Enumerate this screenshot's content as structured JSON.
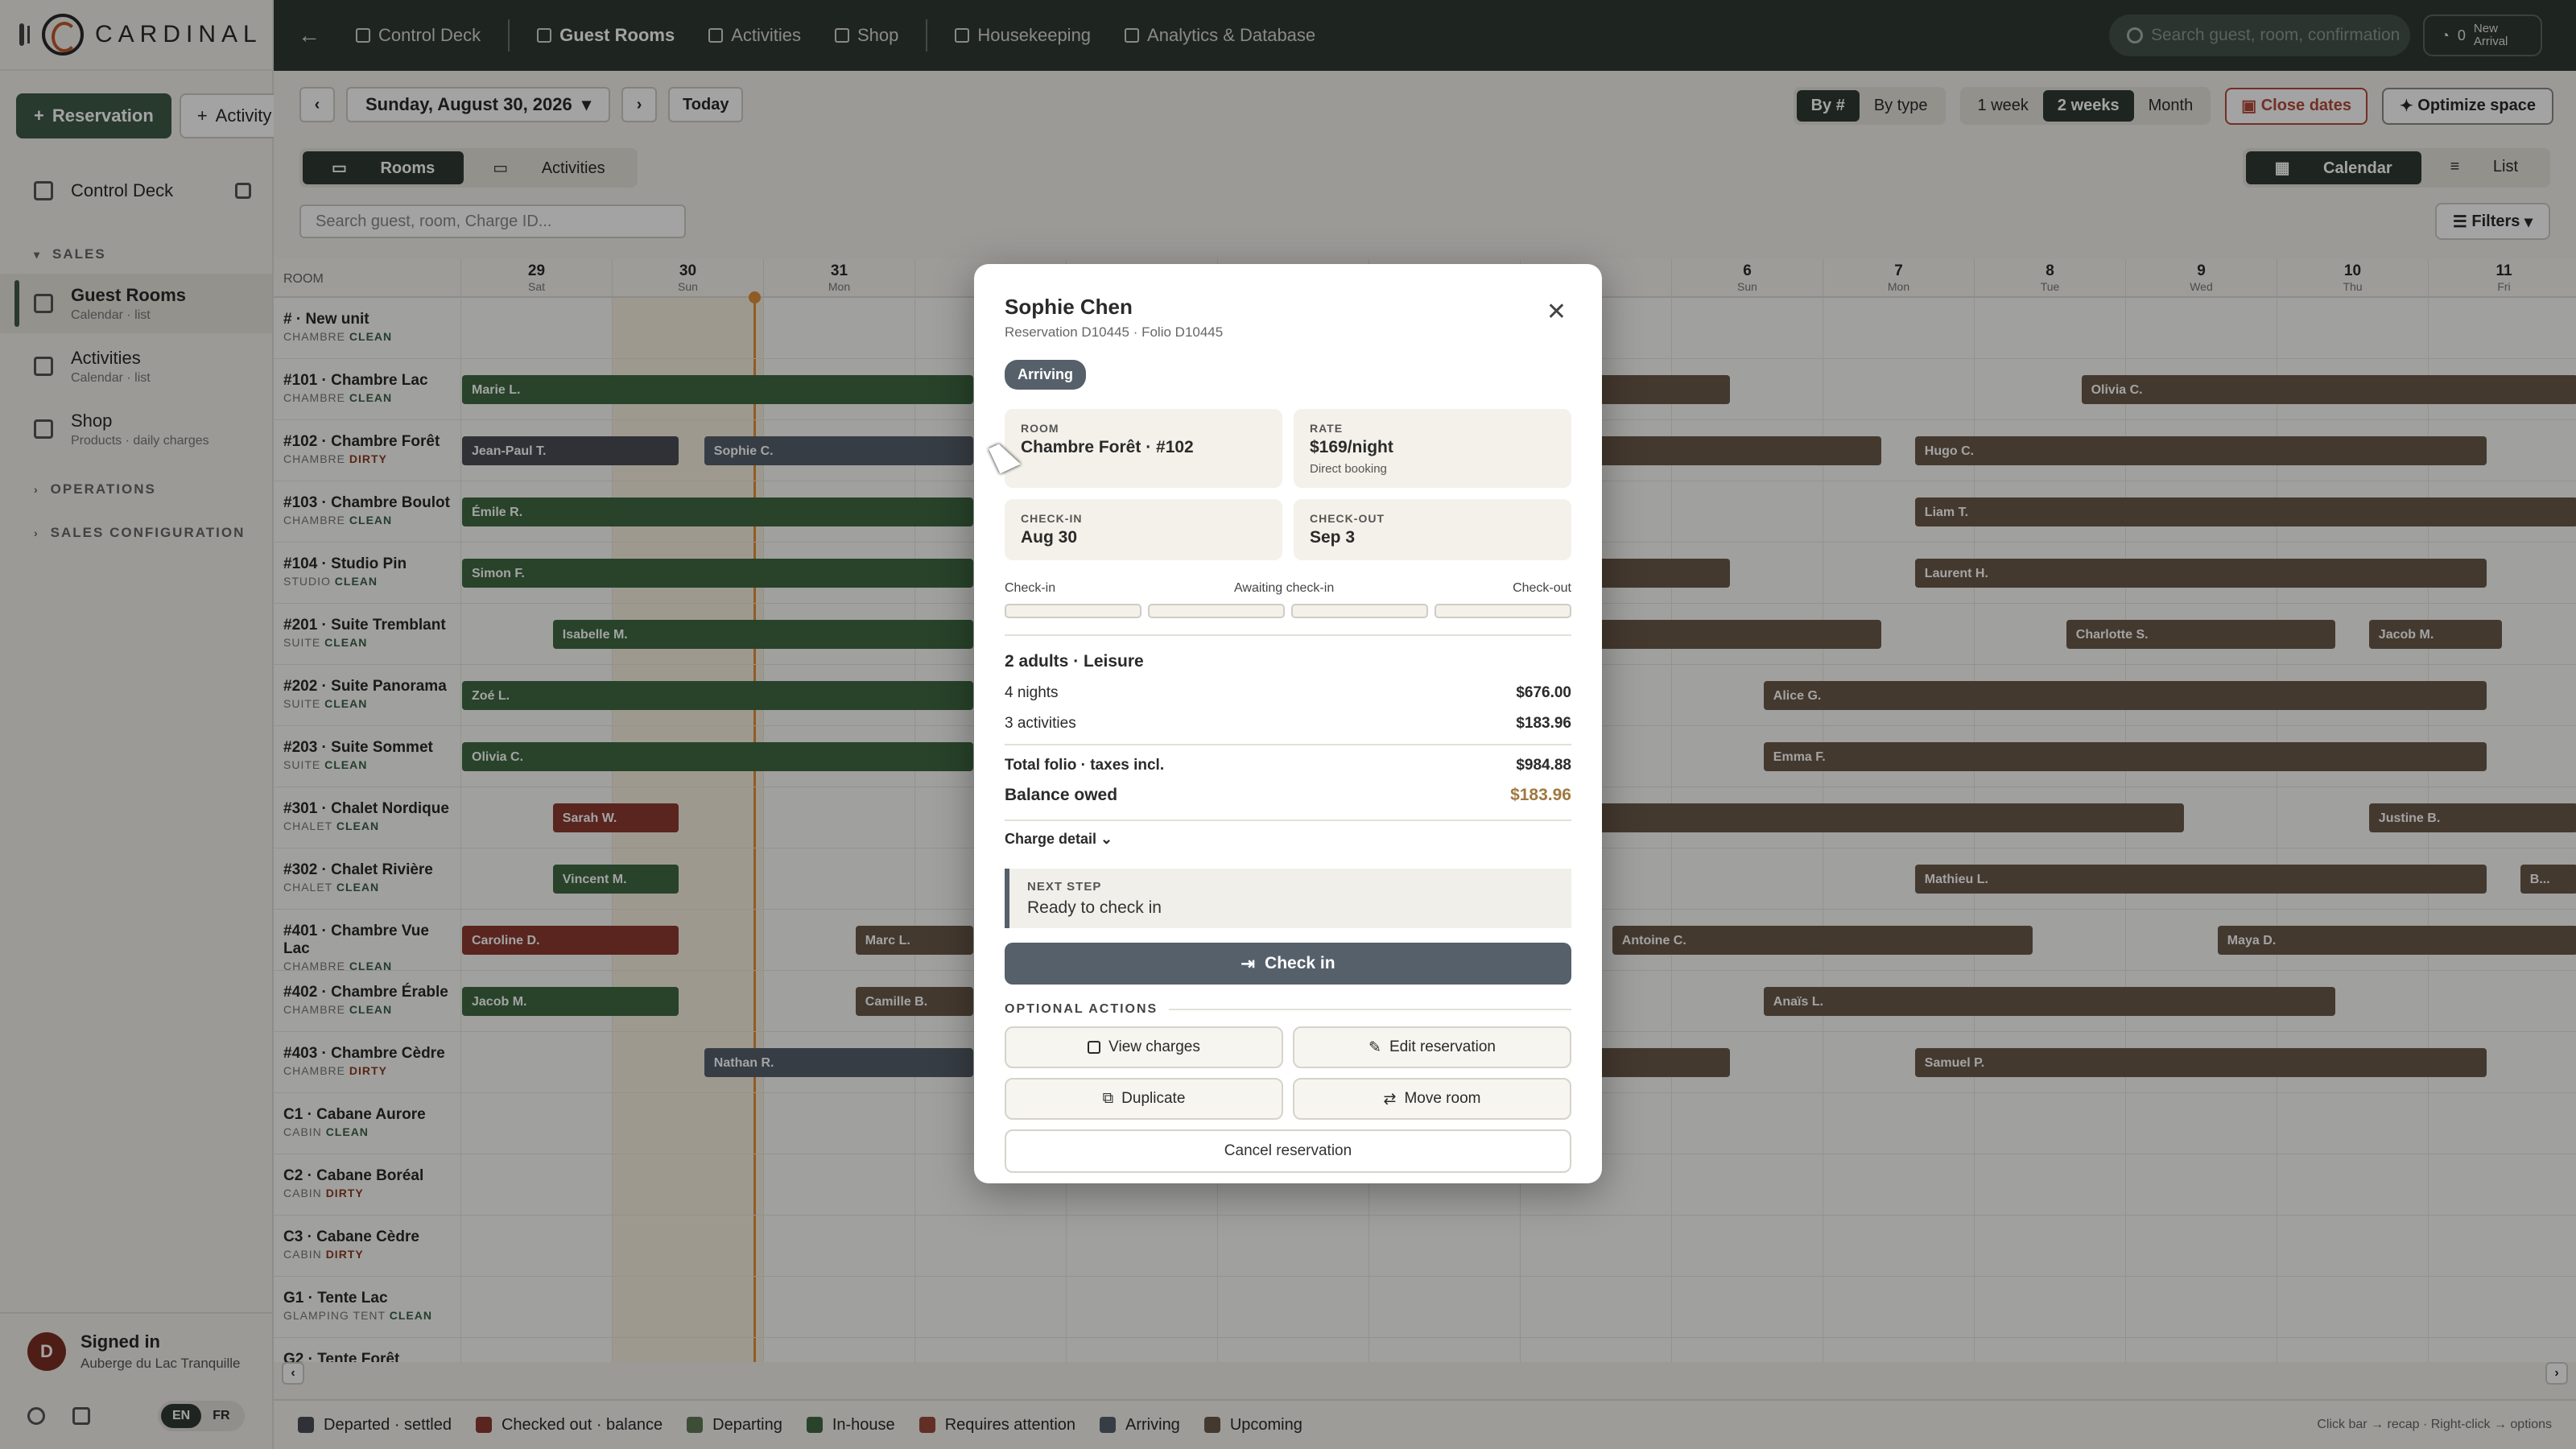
{
  "app": {
    "brand": "CARDINAL"
  },
  "sidebar": {
    "reservation_btn": "Reservation",
    "activity_btn": "Activity",
    "control_deck": "Control Deck",
    "sales_label": "SALES",
    "items": [
      {
        "label": "Guest Rooms",
        "sub": "Calendar · list"
      },
      {
        "label": "Activities",
        "sub": "Calendar · list"
      },
      {
        "label": "Shop",
        "sub": "Products · daily charges"
      }
    ],
    "operations": "OPERATIONS",
    "sales_config": "SALES CONFIGURATION",
    "signed_in": "Signed in",
    "property": "Auberge du Lac Tranquille",
    "avatar": "D",
    "lang_en": "EN",
    "lang_fr": "FR"
  },
  "topbar": {
    "nav": [
      "Control Deck",
      "Guest Rooms",
      "Activities",
      "Shop",
      "Housekeeping",
      "Analytics & Database"
    ],
    "search_placeholder": "Search guest, room, confirmation",
    "arrival_count": "0",
    "arrival_label_1": "New",
    "arrival_label_2": "Arrival"
  },
  "toolbar": {
    "date": "Sunday, August 30, 2026",
    "today": "Today",
    "by_num": "By #",
    "by_type": "By type",
    "w1": "1 week",
    "w2": "2 weeks",
    "month": "Month",
    "close_dates": "Close dates",
    "optimize": "Optimize space",
    "tab_rooms": "Rooms",
    "tab_activities": "Activities",
    "calendar": "Calendar",
    "list": "List",
    "search_placeholder": "Search guest, room, Charge ID...",
    "filters": "Filters"
  },
  "grid": {
    "room_header": "ROOM",
    "days": [
      {
        "d": "29",
        "w": "Sat"
      },
      {
        "d": "30",
        "w": "Sun"
      },
      {
        "d": "31",
        "w": "Mon"
      },
      {
        "d": "",
        "w": ""
      },
      {
        "d": "",
        "w": ""
      },
      {
        "d": "",
        "w": ""
      },
      {
        "d": "",
        "w": ""
      },
      {
        "d": "",
        "w": ""
      },
      {
        "d": "6",
        "w": "Sun"
      },
      {
        "d": "7",
        "w": "Mon"
      },
      {
        "d": "8",
        "w": "Tue"
      },
      {
        "d": "9",
        "w": "Wed"
      },
      {
        "d": "10",
        "w": "Thu"
      },
      {
        "d": "11",
        "w": "Fri"
      }
    ],
    "rooms": [
      {
        "name": "# · New unit",
        "type": "CHAMBRE",
        "status": "CLEAN"
      },
      {
        "name": "#101 · Chambre Lac",
        "type": "CHAMBRE",
        "status": "CLEAN"
      },
      {
        "name": "#102 · Chambre Forêt",
        "type": "CHAMBRE",
        "status": "DIRTY"
      },
      {
        "name": "#103 · Chambre Boulot",
        "type": "CHAMBRE",
        "status": "CLEAN"
      },
      {
        "name": "#104 · Studio Pin",
        "type": "STUDIO",
        "status": "CLEAN"
      },
      {
        "name": "#201 · Suite Tremblant",
        "type": "SUITE",
        "status": "CLEAN"
      },
      {
        "name": "#202 · Suite Panorama",
        "type": "SUITE",
        "status": "CLEAN"
      },
      {
        "name": "#203 · Suite Sommet",
        "type": "SUITE",
        "status": "CLEAN"
      },
      {
        "name": "#301 · Chalet Nordique",
        "type": "CHALET",
        "status": "CLEAN"
      },
      {
        "name": "#302 · Chalet Rivière",
        "type": "CHALET",
        "status": "CLEAN"
      },
      {
        "name": "#401 · Chambre Vue Lac",
        "type": "CHAMBRE",
        "status": "CLEAN"
      },
      {
        "name": "#402 · Chambre Érable",
        "type": "CHAMBRE",
        "status": "CLEAN"
      },
      {
        "name": "#403 · Chambre Cèdre",
        "type": "CHAMBRE",
        "status": "DIRTY"
      },
      {
        "name": "C1 · Cabane Aurore",
        "type": "CABIN",
        "status": "CLEAN"
      },
      {
        "name": "C2 · Cabane Boréal",
        "type": "CABIN",
        "status": "DIRTY"
      },
      {
        "name": "C3 · Cabane Cèdre",
        "type": "CABIN",
        "status": "DIRTY"
      },
      {
        "name": "G1 · Tente Lac",
        "type": "GLAMPING TENT",
        "status": "CLEAN"
      },
      {
        "name": "G2 · Tente Forêt",
        "type": "",
        "status": ""
      }
    ],
    "bars": [
      {
        "row": 1,
        "start": 0,
        "len": 3.4,
        "label": "Marie L.",
        "color": "green"
      },
      {
        "row": 1,
        "start": 7.5,
        "len": 0.9,
        "label": "",
        "color": "brown"
      },
      {
        "row": 1,
        "start": 10.7,
        "len": 3.3,
        "label": "Olivia C.",
        "color": "brown"
      },
      {
        "row": 2,
        "start": 0,
        "len": 1.45,
        "label": "Jean-Paul T.",
        "color": "dark"
      },
      {
        "row": 2,
        "start": 1.6,
        "len": 1.8,
        "label": "Sophie C.",
        "color": "slate"
      },
      {
        "row": 2,
        "start": 7.5,
        "len": 1.9,
        "label": "",
        "color": "brown"
      },
      {
        "row": 2,
        "start": 9.6,
        "len": 3.8,
        "label": "Hugo C.",
        "color": "brown"
      },
      {
        "row": 3,
        "start": 0,
        "len": 3.4,
        "label": "Émile R.",
        "color": "green"
      },
      {
        "row": 3,
        "start": 9.6,
        "len": 4.4,
        "label": "Liam T.",
        "color": "brown"
      },
      {
        "row": 4,
        "start": 0,
        "len": 3.4,
        "label": "Simon F.",
        "color": "green"
      },
      {
        "row": 4,
        "start": 7.5,
        "len": 0.9,
        "label": "",
        "color": "brown"
      },
      {
        "row": 4,
        "start": 9.6,
        "len": 3.8,
        "label": "Laurent H.",
        "color": "brown"
      },
      {
        "row": 5,
        "start": 0.6,
        "len": 2.8,
        "label": "Isabelle M.",
        "color": "green"
      },
      {
        "row": 5,
        "start": 7.5,
        "len": 1.9,
        "label": "",
        "color": "brown"
      },
      {
        "row": 5,
        "start": 10.6,
        "len": 1.8,
        "label": "Charlotte S.",
        "color": "brown"
      },
      {
        "row": 5,
        "start": 12.6,
        "len": 0.9,
        "label": "Jacob M.",
        "color": "brown"
      },
      {
        "row": 6,
        "start": 0,
        "len": 3.4,
        "label": "Zoé L.",
        "color": "green"
      },
      {
        "row": 6,
        "start": 8.6,
        "len": 4.8,
        "label": "Alice G.",
        "color": "brown"
      },
      {
        "row": 7,
        "start": 0,
        "len": 3.4,
        "label": "Olivia C.",
        "color": "green"
      },
      {
        "row": 7,
        "start": 8.6,
        "len": 4.8,
        "label": "Emma F.",
        "color": "brown"
      },
      {
        "row": 8,
        "start": 0.6,
        "len": 0.85,
        "label": "Sarah W.",
        "color": "red"
      },
      {
        "row": 8,
        "start": 7.5,
        "len": 3.9,
        "label": "",
        "color": "brown"
      },
      {
        "row": 8,
        "start": 12.6,
        "len": 1.4,
        "label": "Justine B.",
        "color": "brown"
      },
      {
        "row": 9,
        "start": 0.6,
        "len": 0.85,
        "label": "Vincent M.",
        "color": "green"
      },
      {
        "row": 9,
        "start": 9.6,
        "len": 3.8,
        "label": "Mathieu L.",
        "color": "brown"
      },
      {
        "row": 9,
        "start": 13.6,
        "len": 0.4,
        "label": "B...",
        "color": "brown"
      },
      {
        "row": 10,
        "start": 0,
        "len": 1.45,
        "label": "Caroline D.",
        "color": "red"
      },
      {
        "row": 10,
        "start": 2.6,
        "len": 0.8,
        "label": "Marc L.",
        "color": "brown"
      },
      {
        "row": 10,
        "start": 7.6,
        "len": 2.8,
        "label": "Antoine C.",
        "color": "brown"
      },
      {
        "row": 10,
        "start": 11.6,
        "len": 2.4,
        "label": "Maya D.",
        "color": "brown"
      },
      {
        "row": 11,
        "start": 0,
        "len": 1.45,
        "label": "Jacob M.",
        "color": "green"
      },
      {
        "row": 11,
        "start": 2.6,
        "len": 0.8,
        "label": "Camille B.",
        "color": "brown"
      },
      {
        "row": 11,
        "start": 8.6,
        "len": 3.8,
        "label": "Anaïs L.",
        "color": "brown"
      },
      {
        "row": 12,
        "start": 1.6,
        "len": 1.8,
        "label": "Nathan R.",
        "color": "slate"
      },
      {
        "row": 12,
        "start": 7.5,
        "len": 0.9,
        "label": "",
        "color": "brown"
      },
      {
        "row": 12,
        "start": 9.6,
        "len": 3.8,
        "label": "Samuel P.",
        "color": "brown"
      }
    ]
  },
  "legend": {
    "items": [
      {
        "label": "Departed · settled",
        "color": "#4a4e55"
      },
      {
        "label": "Checked out · balance",
        "color": "#8c3b30"
      },
      {
        "label": "Departing",
        "color": "#5f7a55"
      },
      {
        "label": "In-house",
        "color": "#3f6a43"
      },
      {
        "label": "Requires attention",
        "color": "#9a4a3a"
      },
      {
        "label": "Arriving",
        "color": "#56606b"
      },
      {
        "label": "Upcoming",
        "color": "#6b5a4a"
      }
    ],
    "hint": "Click bar → recap · Right-click → options"
  },
  "modal": {
    "guest": "Sophie Chen",
    "sub": "Reservation D10445 · Folio D10445",
    "badge": "Arriving",
    "room_k": "ROOM",
    "room_v": "Chambre Forêt · #102",
    "rate_k": "RATE",
    "rate_v": "$169/night",
    "rate_x": "Direct booking",
    "checkin_k": "CHECK-IN",
    "checkin_v": "Aug 30",
    "checkout_k": "CHECK-OUT",
    "checkout_v": "Sep 3",
    "prog_left": "Check-in",
    "prog_mid": "Awaiting check-in",
    "prog_right": "Check-out",
    "party": "2 adults · Leisure",
    "nights_l": "4 nights",
    "nights_v": "$676.00",
    "acts_l": "3 activities",
    "acts_v": "$183.96",
    "total_l": "Total folio · taxes incl.",
    "total_v": "$984.88",
    "bal_l": "Balance owed",
    "bal_v": "$183.96",
    "charge_detail": "Charge detail",
    "next_k": "NEXT STEP",
    "next_v": "Ready to check in",
    "checkin_btn": "Check in",
    "optional": "OPTIONAL ACTIONS",
    "view_charges": "View charges",
    "edit_res": "Edit reservation",
    "duplicate": "Duplicate",
    "move_room": "Move room",
    "cancel": "Cancel reservation"
  },
  "colors": {
    "green": "#3f6a43",
    "brown": "#6b5a4a",
    "red": "#8c3b30",
    "slate": "#56606b",
    "dark": "#4a4e55"
  }
}
